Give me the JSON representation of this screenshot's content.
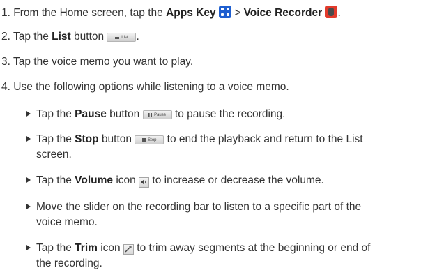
{
  "steps": [
    {
      "number": "1.",
      "pre": "From the Home screen, tap the",
      "apps_key": "Apps Key",
      "sep": ">",
      "voice_recorder": "Voice Recorder",
      "end": "."
    },
    {
      "number": "2.",
      "pre": "Tap the",
      "bold": "List",
      "mid": "button",
      "end": "."
    },
    {
      "number": "3.",
      "text": "Tap the voice memo you want to play."
    },
    {
      "number": "4.",
      "text": "Use the following options while listening to a voice memo."
    }
  ],
  "options": [
    {
      "pre": "Tap the",
      "bold": "Pause",
      "mid": "button",
      "post": "to pause the recording."
    },
    {
      "pre": "Tap the",
      "bold": "Stop",
      "mid": "button",
      "post": "to end the playback and return to the List",
      "cont": "screen."
    },
    {
      "pre": "Tap the",
      "bold": "Volume",
      "mid": "icon",
      "post": "to increase or decrease the volume."
    },
    {
      "text": "Move the slider on the recording bar to listen to a specific part of the",
      "cont": "voice memo."
    },
    {
      "pre": "Tap the",
      "bold": "Trim",
      "mid": "icon",
      "post": "to trim away segments at the beginning or end of",
      "cont": "the recording."
    }
  ],
  "buttons": {
    "list_label": "List",
    "pause_label": "Pause",
    "stop_label": "Stop"
  },
  "icons": {
    "apps_key": "apps-grid-icon",
    "voice_recorder": "voice-recorder-icon",
    "list": "list-icon",
    "pause": "pause-icon",
    "stop": "stop-icon",
    "volume": "volume-icon",
    "trim": "trim-icon"
  },
  "colors": {
    "text": "#333333",
    "apps_key": "#1f5fd0",
    "voice_recorder": "#e23b2c"
  }
}
